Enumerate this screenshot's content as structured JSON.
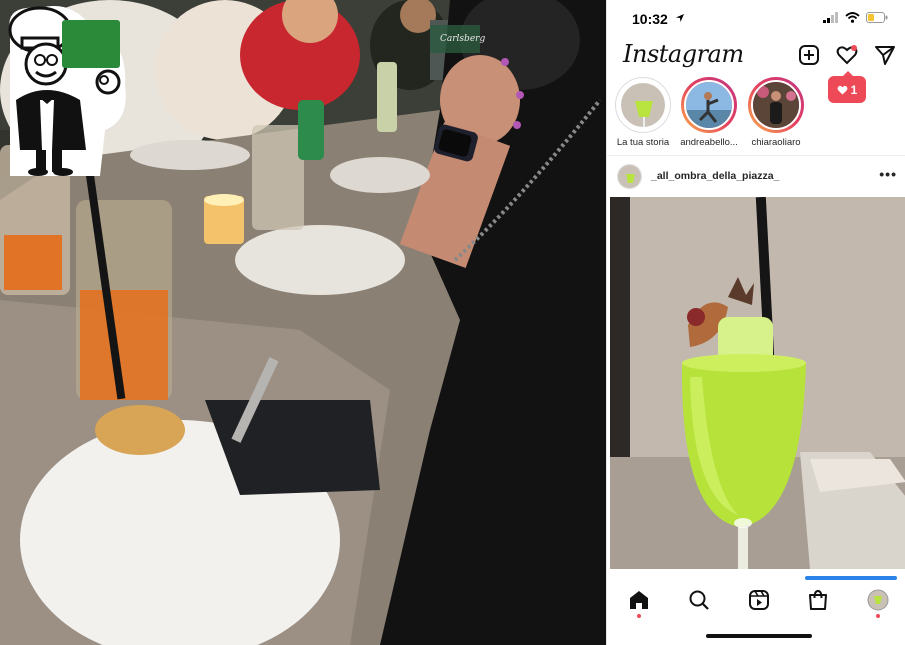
{
  "status_bar": {
    "time": "10:32",
    "icons": [
      "location-arrow-icon",
      "signal-icon",
      "wifi-icon",
      "battery-icon"
    ]
  },
  "header": {
    "logo": "Instagram",
    "icons": [
      "new-post-icon",
      "activity-heart-icon",
      "direct-message-icon"
    ]
  },
  "notification": {
    "count": "1",
    "icon": "heart-icon"
  },
  "stories": [
    {
      "label": "La tua storia",
      "ring": "seen"
    },
    {
      "label": "andreabello...",
      "ring": "new"
    },
    {
      "label": "chiaraoliaro",
      "ring": "new"
    }
  ],
  "post": {
    "username": "_all_ombra_della_piazza_",
    "more": "•••"
  },
  "tab_bar": {
    "tabs": [
      "home-icon",
      "search-icon",
      "reels-icon",
      "shop-icon",
      "profile-icon"
    ]
  },
  "colors": {
    "notification_red": "#ed4956",
    "cocktail_green": "#b6e23a",
    "chef_badge_green": "#2a8a3a"
  },
  "photo_left": {
    "sign_text": "Carlsberg"
  }
}
